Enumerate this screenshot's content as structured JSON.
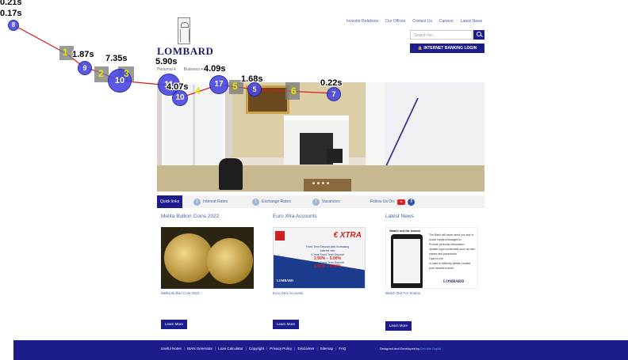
{
  "logo": {
    "text": "LOMBARD"
  },
  "top_nav": [
    "Investor Relations",
    "Our Offices",
    "Contact Us",
    "Careers",
    "Latest News"
  ],
  "search": {
    "placeholder": "Search for..."
  },
  "ib_login": {
    "label": "INTERNET BANKING LOGIN"
  },
  "main_nav": [
    "Personal ▾",
    "Business ▾"
  ],
  "quick_links": {
    "title": "Quick links",
    "items": [
      {
        "num": "1",
        "label": "Interest Rates"
      },
      {
        "num": "1",
        "label": "Exchange Rates"
      },
      {
        "num": "1",
        "label": "Vacancies"
      }
    ],
    "follow": "Follow Us On:"
  },
  "columns": [
    {
      "title": "Melita Bullion Coins 2022",
      "caption": "Melita Bullion Coin 2022",
      "button": "Learn More"
    },
    {
      "title": "Euro Xtra Accounts",
      "caption": "Euro Xtra Accounts",
      "button": "Learn More"
    },
    {
      "title": "Latest News",
      "caption": "Watch Out For Scams",
      "button": "Learn More"
    }
  ],
  "promo_extra": {
    "logo": "€ XTRA",
    "line1": "Fixed Term Deposit with Increasing Interest rate",
    "line2": "6-Year Fixed Term Deposit",
    "rate1": "2.50% – 5.00%",
    "line3": "5-Year Fixed Term Deposit",
    "rate2": "2.50% – 5.50%",
    "brand": "LOMBARD"
  },
  "promo_scam": {
    "heading": "Watch out for scams",
    "lines": [
      "The Bank will never send you text or social media messages to:",
      "Provide personal information",
      "Update login credentials such as user names and passwords",
      "Open a link",
      "In case of difficulty please contact your nearest branch."
    ],
    "brand": "LOMBARD"
  },
  "footer": {
    "links": [
      "Useful Notes",
      "IBAN Generator",
      "Loan Calculator",
      "Copyright",
      "Privacy Policy",
      "Disclaimer",
      "Sitemap",
      "FAQ"
    ],
    "credit_prefix": "Designed and Developed by",
    "credit_name": "Deloitte Digital"
  },
  "overlay": {
    "time_labels": [
      "0.21s",
      "0.17s",
      "1.87s",
      "7.35s",
      "5.90s",
      "4.09s",
      "1.68s",
      "4.07s",
      "0.22s"
    ],
    "markers": [
      "8",
      "9",
      "10",
      "11",
      "10",
      "17",
      "5",
      "7"
    ],
    "steps": [
      "1",
      "2",
      "3",
      "4",
      "5",
      "6"
    ]
  }
}
